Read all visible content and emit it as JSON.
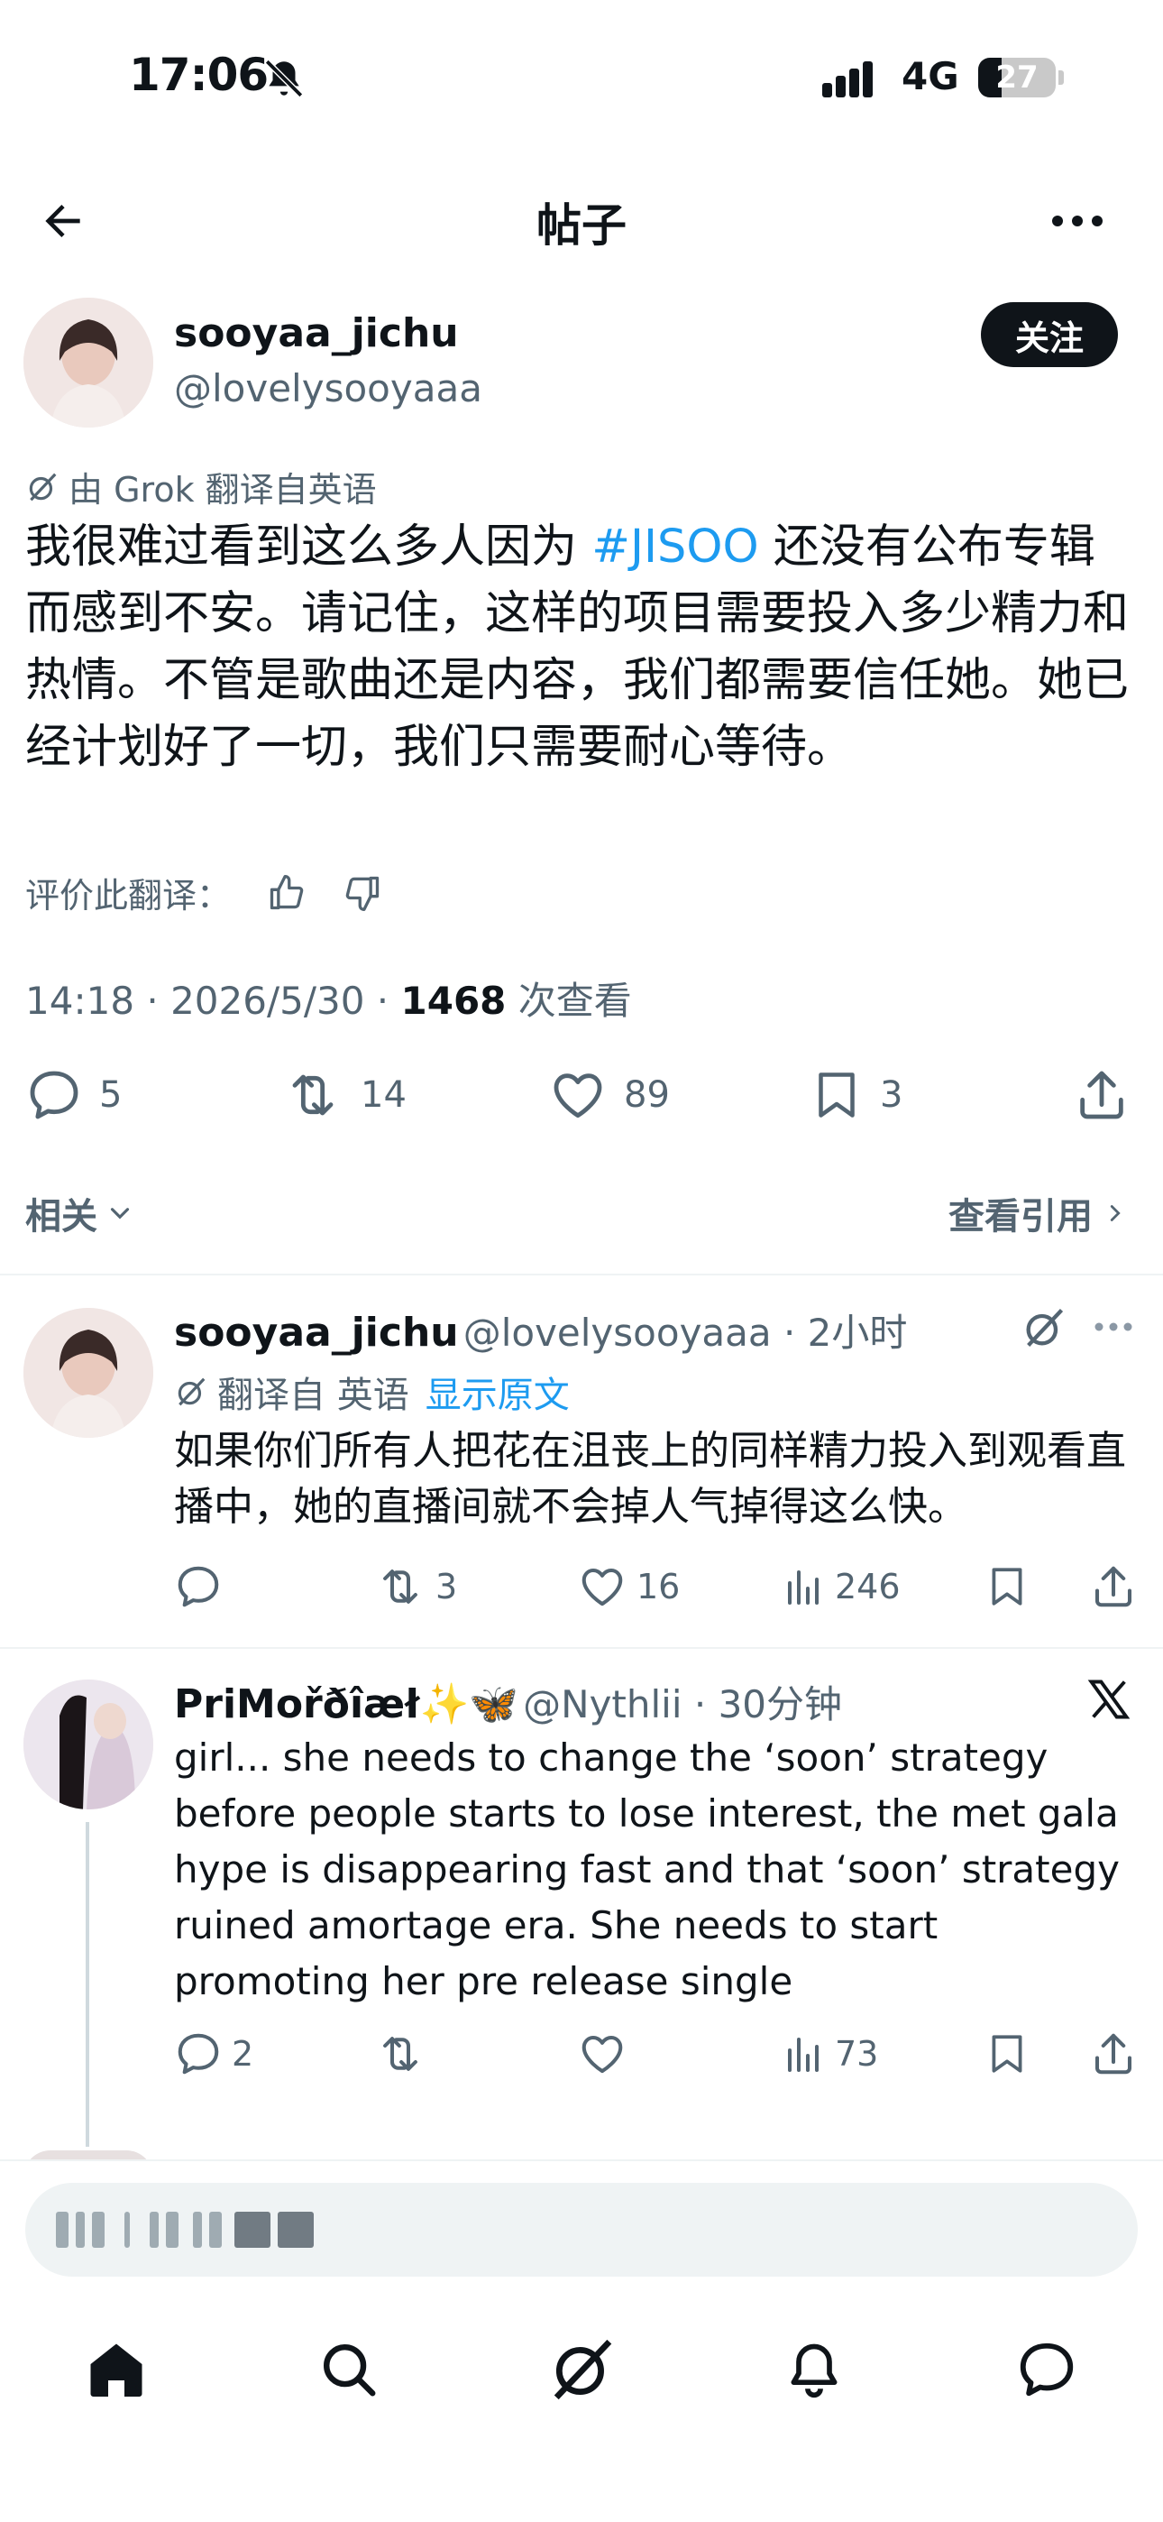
{
  "status_bar": {
    "time": "17:06",
    "network": "4G",
    "battery": "27"
  },
  "header": {
    "title": "帖子"
  },
  "post": {
    "name": "sooyaa_jichu",
    "handle": "@lovelysooyaaa",
    "follow_label": "关注",
    "translation_note": "由 Grok 翻译自英语",
    "text_before": "我很难过看到这么多人因为 ",
    "hashtag": "#JISOO",
    "text_after": " 还没有公布专辑而感到不安。请记住，这样的项目需要投入多少精力和热情。不管是歌曲还是内容，我们都需要信任她。她已经计划好了一切，我们只需要耐心等待。",
    "rate_translation": "评价此翻译：",
    "time": "14:18 · 2026/5/30 · ",
    "views": "1468",
    "views_label": " 次查看",
    "stats": {
      "replies": "5",
      "reposts": "14",
      "likes": "89",
      "bookmarks": "3"
    }
  },
  "related": {
    "label": "相关",
    "quotes_label": "查看引用"
  },
  "replies": [
    {
      "name": "sooyaa_jichu",
      "handle": "@lovelysooyaaa · 2小时",
      "translation_note": "翻译自 英语",
      "show_original": "显示原文",
      "text": "如果你们所有人把花在沮丧上的同样精力投入到观看直播中，她的直播间就不会掉人气掉得这么快。",
      "stats": {
        "replies": "",
        "reposts": "3",
        "likes": "16",
        "views": "246"
      }
    },
    {
      "name": "PriMořðîæł✨🦋",
      "handle": "@Nythlii · 30分钟",
      "text": "girl... she needs to change the ‘soon’ strategy before people starts to lose interest, the met gala hype is disappearing fast and that ‘soon’ strategy ruined amortage era. She needs to start promoting her pre release single",
      "stats": {
        "replies": "2",
        "reposts": "",
        "likes": "",
        "views": "73"
      }
    }
  ],
  "icons": [
    "back-arrow-icon",
    "more-icon",
    "grok-icon",
    "thumbs-up-icon",
    "thumbs-down-icon",
    "reply-icon",
    "repost-icon",
    "like-icon",
    "bookmark-icon",
    "share-icon",
    "views-icon",
    "x-logo-icon",
    "home-icon",
    "search-icon",
    "grok-tab-icon",
    "notifications-icon",
    "messages-icon"
  ]
}
